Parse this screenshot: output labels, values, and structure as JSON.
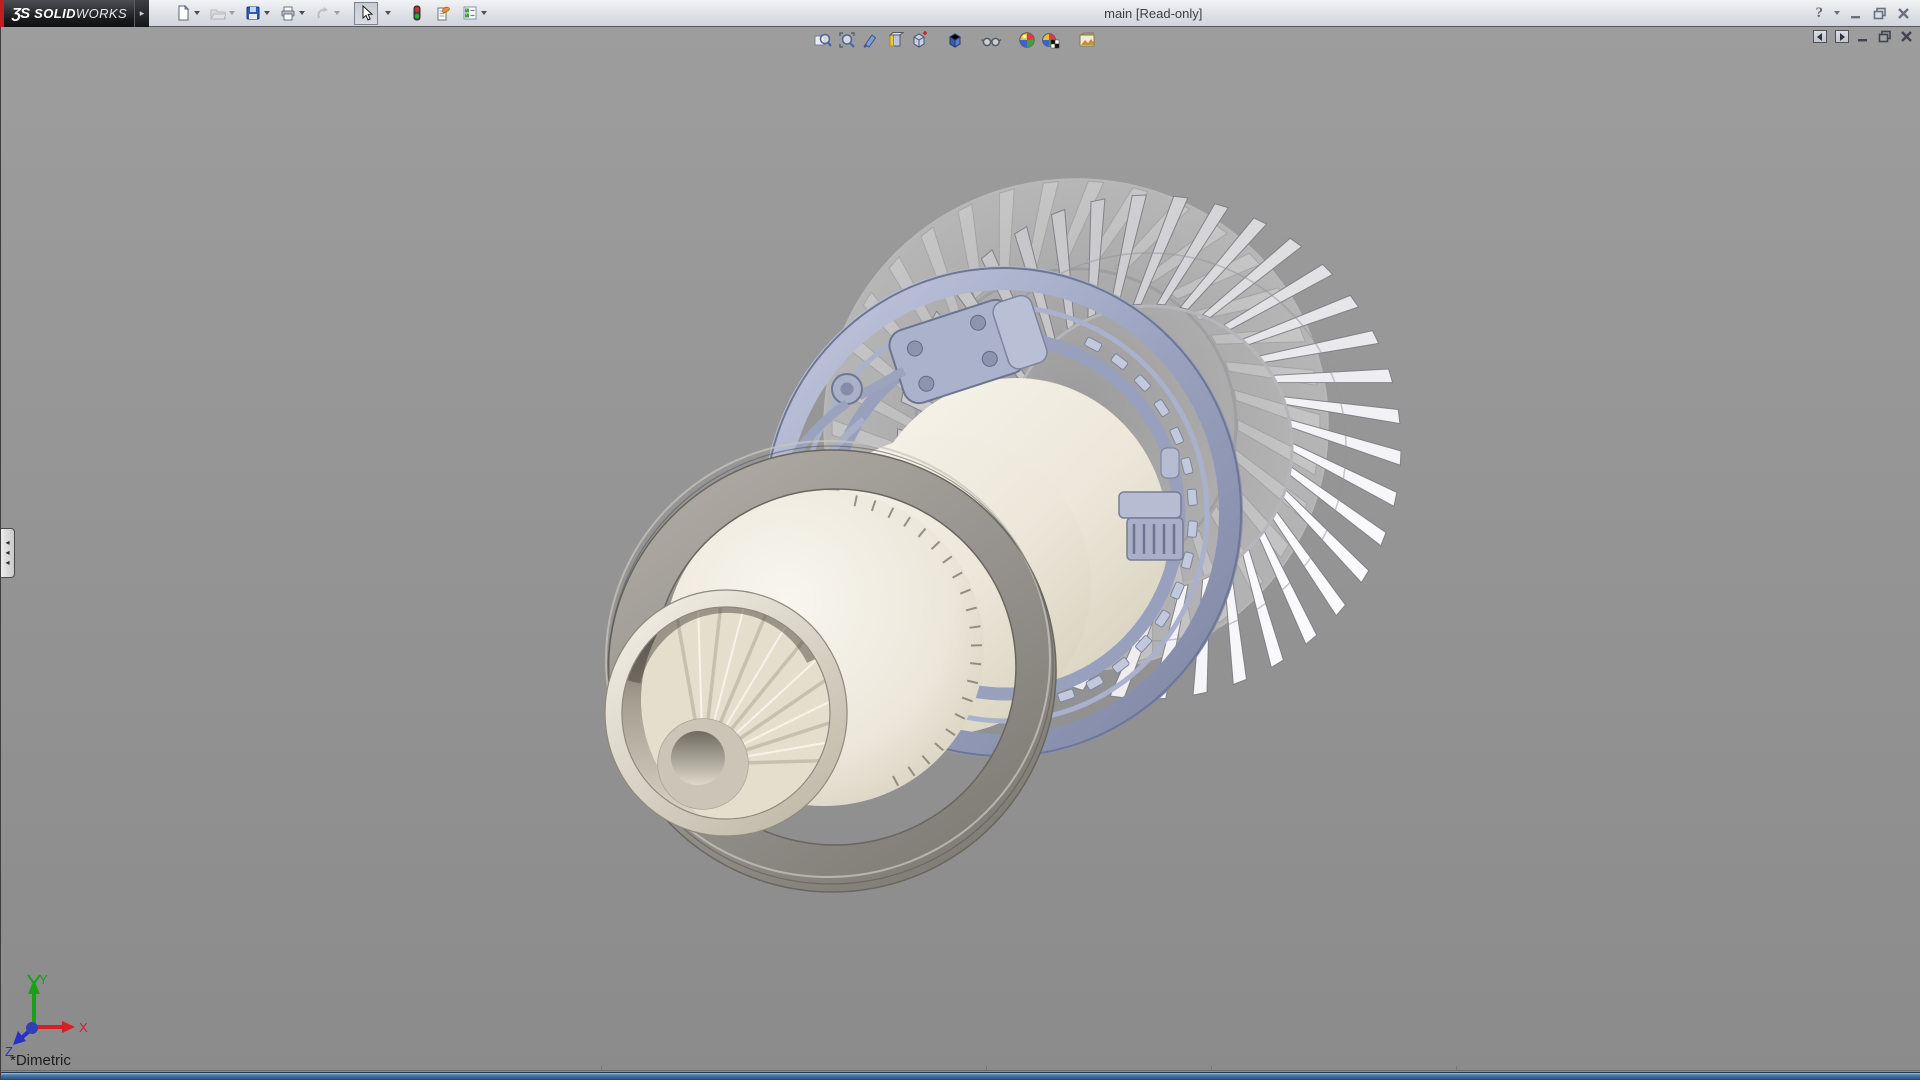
{
  "titlebar": {
    "brand_mark": "ƷS",
    "brand_bold": "SOLID",
    "brand_light": "WORKS",
    "menu_expand_arrow": "▸",
    "document_title": "main [Read-only]",
    "help_glyph": "?",
    "toolbar": [
      {
        "name": "new-document",
        "tooltip": "New"
      },
      {
        "name": "open",
        "tooltip": "Open"
      },
      {
        "name": "save",
        "tooltip": "Save"
      },
      {
        "name": "print",
        "tooltip": "Print"
      },
      {
        "name": "undo",
        "tooltip": "Undo"
      },
      {
        "name": "select",
        "tooltip": "Select"
      },
      {
        "name": "rebuild",
        "tooltip": "Rebuild"
      },
      {
        "name": "file-properties",
        "tooltip": "File Properties"
      },
      {
        "name": "options",
        "tooltip": "Options"
      }
    ],
    "window_controls": [
      {
        "name": "help",
        "tooltip": "Help"
      },
      {
        "name": "minimize",
        "tooltip": "Minimize"
      },
      {
        "name": "restore",
        "tooltip": "Restore Down"
      },
      {
        "name": "close",
        "tooltip": "Close"
      }
    ]
  },
  "headsup_toolbar": {
    "items": [
      {
        "name": "zoom-to-fit",
        "tooltip": "Zoom to Fit"
      },
      {
        "name": "zoom-to-area",
        "tooltip": "Zoom to Area"
      },
      {
        "name": "previous-view",
        "tooltip": "Previous View"
      },
      {
        "name": "section-view",
        "tooltip": "Section View"
      },
      {
        "name": "view-orientation",
        "tooltip": "View Orientation"
      },
      {
        "name": "display-style",
        "tooltip": "Display Style"
      },
      {
        "name": "hide-show-items",
        "tooltip": "Hide/Show Items"
      },
      {
        "name": "edit-appearance",
        "tooltip": "Edit Appearance"
      },
      {
        "name": "apply-scene",
        "tooltip": "Apply Scene"
      },
      {
        "name": "view-settings",
        "tooltip": "View Settings"
      }
    ]
  },
  "doc_window_controls": [
    {
      "name": "previous-pane",
      "tooltip": "Previous Pane"
    },
    {
      "name": "next-pane",
      "tooltip": "Next Pane"
    },
    {
      "name": "minimize-document",
      "tooltip": "Minimize"
    },
    {
      "name": "restore-document",
      "tooltip": "Restore"
    },
    {
      "name": "close-document",
      "tooltip": "Close"
    }
  ],
  "viewport": {
    "view_orientation_label": "*Dimetric",
    "background_top": "#9d9d9d",
    "background_bottom": "#8b8b8b",
    "triad": {
      "x_label": "X",
      "x_color": "#d42020",
      "y_label": "Y",
      "y_color": "#18a018",
      "z_label": "Z",
      "z_color": "#2830c8"
    }
  },
  "left_panel_tab": {
    "arrow": "◂"
  }
}
